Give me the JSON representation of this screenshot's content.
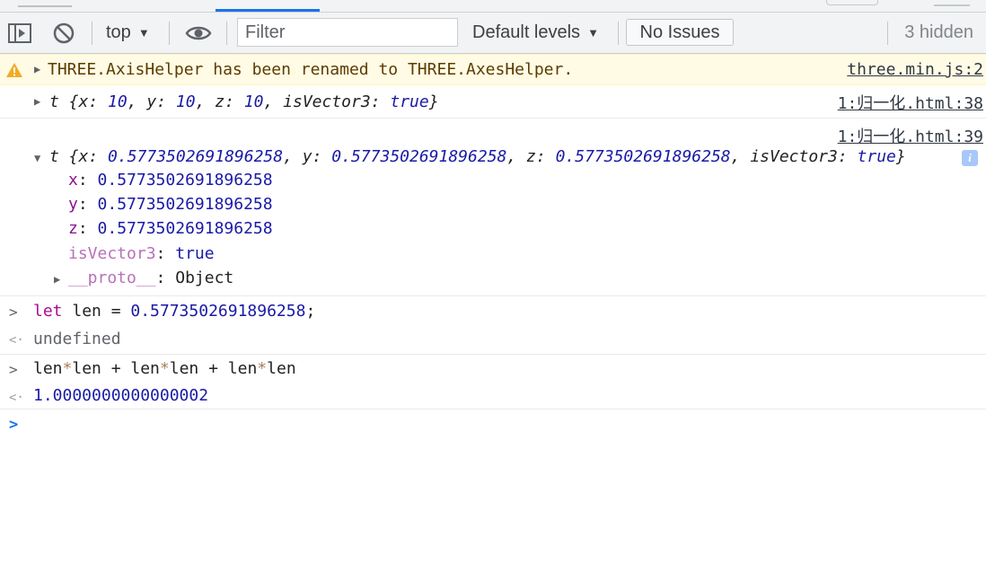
{
  "toolbar": {
    "context": "top",
    "filter_placeholder": "Filter",
    "levels": "Default levels",
    "issues": "No Issues",
    "hidden": "3 hidden",
    "dropdown_arrow": "▼"
  },
  "messages": {
    "warning": {
      "text": "THREE.AxisHelper has been renamed to THREE.AxesHelper.",
      "source": "three.min.js:2"
    },
    "log1": {
      "type": "t",
      "x": "10",
      "y": "10",
      "z": "10",
      "isVector3": "true",
      "source": "1:归一化.html:38"
    },
    "log2": {
      "type": "t",
      "x": "0.5773502691896258",
      "y": "0.5773502691896258",
      "z": "0.5773502691896258",
      "isVector3": "true",
      "proto_key": "__proto__",
      "proto_val": "Object",
      "source": "1:归一化.html:39",
      "info_badge": "i"
    }
  },
  "console": {
    "cmd1": {
      "kw": "let",
      "rest": " len = ",
      "num": "0.5773502691896258",
      "end": ";"
    },
    "res1": "undefined",
    "cmd2": {
      "a": "len",
      "s1": "*",
      "b": "len + len",
      "s2": "*",
      "c": "len + len",
      "s3": "*",
      "d": "len"
    },
    "res2": "1.0000000000000002"
  },
  "icons": {
    "sidebar": "sidebar-toggle-icon",
    "clear": "block-icon",
    "eye": "eye-icon",
    "warning": "warning-icon"
  },
  "colors": {
    "warning_bg": "#fffbe5",
    "accent": "#1a73e8",
    "number": "#1a1aa6",
    "key": "#881391",
    "keyword": "#aa0d91"
  }
}
